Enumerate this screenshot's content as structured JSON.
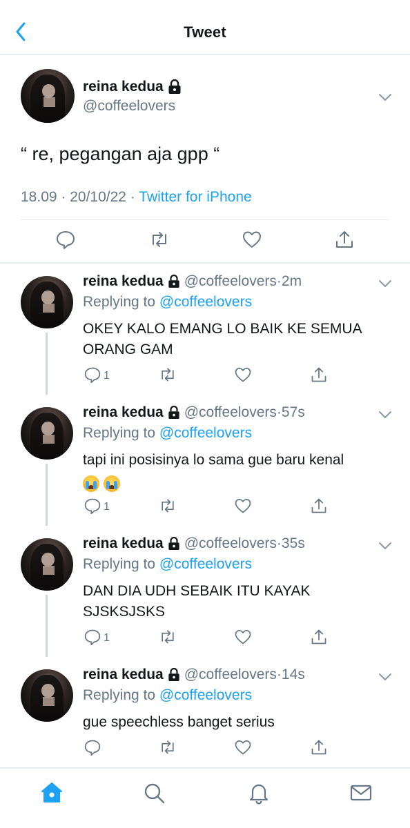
{
  "header": {
    "title": "Tweet"
  },
  "main_tweet": {
    "name": "reina kedua",
    "handle": "@coffeelovers",
    "text": "“ re, pegangan aja gpp “",
    "time": "18.09",
    "date": "20/10/22",
    "via": "Twitter for iPhone"
  },
  "replies": [
    {
      "name": "reina kedua",
      "handle": "@coffeelovers",
      "time": "2m",
      "replying_label": "Replying to",
      "replying_to": "@coffeelovers",
      "text": "OKEY KALO EMANG LO BAIK KE SEMUA ORANG GAM",
      "reply_count": "1"
    },
    {
      "name": "reina kedua",
      "handle": "@coffeelovers",
      "time": "57s",
      "replying_label": "Replying to",
      "replying_to": "@coffeelovers",
      "text": "tapi ini posisinya lo sama gue baru kenal",
      "emoji": [
        "loudly-crying-face",
        "loudly-crying-face"
      ],
      "reply_count": "1"
    },
    {
      "name": "reina kedua",
      "handle": "@coffeelovers",
      "time": "35s",
      "replying_label": "Replying to",
      "replying_to": "@coffeelovers",
      "text": "DAN DIA UDH SEBAIK ITU KAYAK SJSKSJSKS",
      "reply_count": "1"
    },
    {
      "name": "reina kedua",
      "handle": "@coffeelovers",
      "time": "14s",
      "replying_label": "Replying to",
      "replying_to": "@coffeelovers",
      "text": "gue speechless banget serius",
      "reply_count": ""
    }
  ],
  "tabbar": {
    "items": [
      "home-icon",
      "search-icon",
      "notifications-icon",
      "messages-icon"
    ],
    "active": "home-icon"
  },
  "colors": {
    "accent": "#1da1f2",
    "secondary_text": "#657786",
    "divider": "#e6ecf0"
  }
}
